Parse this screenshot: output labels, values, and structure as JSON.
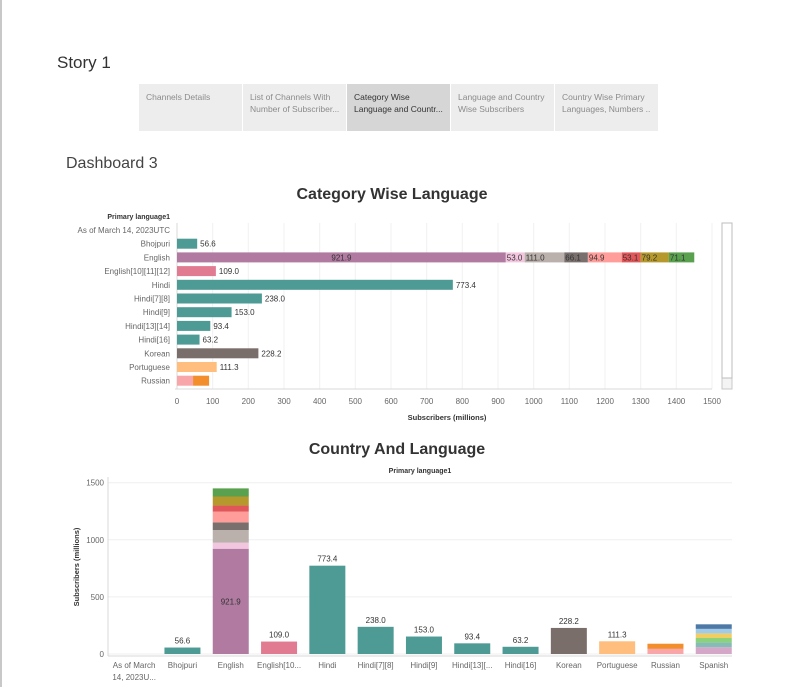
{
  "story": {
    "title": "Story 1",
    "tabs": [
      {
        "line1": "Channels Details",
        "line2": ""
      },
      {
        "line1": "List of Channels With",
        "line2": "Number of Subscriber..."
      },
      {
        "line1": "Category Wise",
        "line2": "Language and Countr..."
      },
      {
        "line1": "Language and Country",
        "line2": "Wise Subscribers"
      },
      {
        "line1": "Country Wise Primary",
        "line2": "Languages, Numbers ..."
      }
    ],
    "active_tab": 2
  },
  "dashboard": {
    "title": "Dashboard 3"
  },
  "colors": {
    "teal": "#4e9a95",
    "purple": "#b07aa1",
    "pink": "#e17b92",
    "gray_dark": "#7a6e6b",
    "orange_light": "#ffbe7d",
    "pink_light": "#f8a6a9",
    "orange": "#f28e2b"
  },
  "chart_data": [
    {
      "type": "bar",
      "orientation": "horizontal",
      "title": "Category Wise  Language",
      "row_header": "Primary language1",
      "xlabel": "Subscribers (millions)",
      "xlim": [
        0,
        1500
      ],
      "xticks": [
        0,
        100,
        200,
        300,
        400,
        500,
        600,
        700,
        800,
        900,
        1000,
        1100,
        1200,
        1300,
        1400,
        1500
      ],
      "rows": [
        {
          "label": "As of March 14, 2023UTC",
          "segments": []
        },
        {
          "label": "Bhojpuri",
          "segments": [
            {
              "value": 56.6,
              "color": "#4e9a95",
              "label": "56.6"
            }
          ]
        },
        {
          "label": "English",
          "segments": [
            {
              "value": 921.9,
              "color": "#b07aa1",
              "label": "921.9"
            },
            {
              "value": 53.0,
              "color": "#f2c6df",
              "label": "53.0"
            },
            {
              "value": 111.0,
              "color": "#bab0ac",
              "label": "111.0"
            },
            {
              "value": 66.1,
              "color": "#79706e",
              "label": "66.1"
            },
            {
              "value": 94.9,
              "color": "#ff9d9a",
              "label": "94.9"
            },
            {
              "value": 53.1,
              "color": "#e15759",
              "label": "53.1"
            },
            {
              "value": 79.2,
              "color": "#b6992d",
              "label": "79.2"
            },
            {
              "value": 71.1,
              "color": "#59a14f",
              "label": "71.1"
            }
          ]
        },
        {
          "label": "English[10][11][12]",
          "segments": [
            {
              "value": 109.0,
              "color": "#e17b92",
              "label": "109.0"
            }
          ]
        },
        {
          "label": "Hindi",
          "segments": [
            {
              "value": 773.4,
              "color": "#4e9a95",
              "label": "773.4"
            }
          ]
        },
        {
          "label": "Hindi[7][8]",
          "segments": [
            {
              "value": 238.0,
              "color": "#4e9a95",
              "label": "238.0"
            }
          ]
        },
        {
          "label": "Hindi[9]",
          "segments": [
            {
              "value": 153.0,
              "color": "#4e9a95",
              "label": "153.0"
            }
          ]
        },
        {
          "label": "Hindi[13][14]",
          "segments": [
            {
              "value": 93.4,
              "color": "#4e9a95",
              "label": "93.4"
            }
          ]
        },
        {
          "label": "Hindi[16]",
          "segments": [
            {
              "value": 63.2,
              "color": "#4e9a95",
              "label": "63.2"
            }
          ]
        },
        {
          "label": "Korean",
          "segments": [
            {
              "value": 228.2,
              "color": "#7a6e6b",
              "label": "228.2"
            }
          ]
        },
        {
          "label": "Portuguese",
          "segments": [
            {
              "value": 111.3,
              "color": "#ffbe7d",
              "label": "111.3"
            }
          ]
        },
        {
          "label": "Russian",
          "segments": [
            {
              "value": 45,
              "color": "#f8a6a9",
              "label": ""
            },
            {
              "value": 45,
              "color": "#f28e2b",
              "label": ""
            }
          ]
        }
      ]
    },
    {
      "type": "bar",
      "orientation": "vertical",
      "title": "Country And Language",
      "col_header": "Primary language1",
      "ylabel": "Subscribers (millions)",
      "ylim": [
        0,
        1550
      ],
      "yticks": [
        0,
        500,
        1000,
        1500
      ],
      "columns": [
        {
          "label": "As of March\n14, 2023U...",
          "segments": []
        },
        {
          "label": "Bhojpuri",
          "segments": [
            {
              "value": 56.6,
              "color": "#4e9a95",
              "label": "56.6"
            }
          ]
        },
        {
          "label": "English",
          "segments": [
            {
              "value": 921.9,
              "color": "#b07aa1",
              "label": "921.9"
            },
            {
              "value": 53.0,
              "color": "#f2c6df",
              "label": ""
            },
            {
              "value": 111.0,
              "color": "#bab0ac",
              "label": ""
            },
            {
              "value": 66.1,
              "color": "#79706e",
              "label": ""
            },
            {
              "value": 94.9,
              "color": "#ff9d9a",
              "label": ""
            },
            {
              "value": 53.1,
              "color": "#e15759",
              "label": ""
            },
            {
              "value": 79.2,
              "color": "#b6992d",
              "label": ""
            },
            {
              "value": 71.1,
              "color": "#59a14f",
              "label": ""
            }
          ]
        },
        {
          "label": "English[10...",
          "segments": [
            {
              "value": 109.0,
              "color": "#e17b92",
              "label": "109.0"
            }
          ]
        },
        {
          "label": "Hindi",
          "segments": [
            {
              "value": 773.4,
              "color": "#4e9a95",
              "label": "773.4"
            }
          ]
        },
        {
          "label": "Hindi[7][8]",
          "segments": [
            {
              "value": 238.0,
              "color": "#4e9a95",
              "label": "238.0"
            }
          ]
        },
        {
          "label": "Hindi[9]",
          "segments": [
            {
              "value": 153.0,
              "color": "#4e9a95",
              "label": "153.0"
            }
          ]
        },
        {
          "label": "Hindi[13][...",
          "segments": [
            {
              "value": 93.4,
              "color": "#4e9a95",
              "label": "93.4"
            }
          ]
        },
        {
          "label": "Hindi[16]",
          "segments": [
            {
              "value": 63.2,
              "color": "#4e9a95",
              "label": "63.2"
            }
          ]
        },
        {
          "label": "Korean",
          "segments": [
            {
              "value": 228.2,
              "color": "#7a6e6b",
              "label": "228.2"
            }
          ]
        },
        {
          "label": "Portuguese",
          "segments": [
            {
              "value": 111.3,
              "color": "#ffbe7d",
              "label": "111.3"
            }
          ]
        },
        {
          "label": "Russian",
          "segments": [
            {
              "value": 45,
              "color": "#f8a6a9",
              "label": ""
            },
            {
              "value": 45,
              "color": "#f28e2b",
              "label": ""
            }
          ]
        },
        {
          "label": "Spanish",
          "segments": [
            {
              "value": 60,
              "color": "#d4a6c8",
              "label": ""
            },
            {
              "value": 40,
              "color": "#86bcb6",
              "label": ""
            },
            {
              "value": 40,
              "color": "#8cd17d",
              "label": ""
            },
            {
              "value": 40,
              "color": "#f1ce63",
              "label": ""
            },
            {
              "value": 40,
              "color": "#a0cbe8",
              "label": ""
            },
            {
              "value": 40,
              "color": "#4e79a7",
              "label": ""
            }
          ]
        }
      ]
    }
  ]
}
